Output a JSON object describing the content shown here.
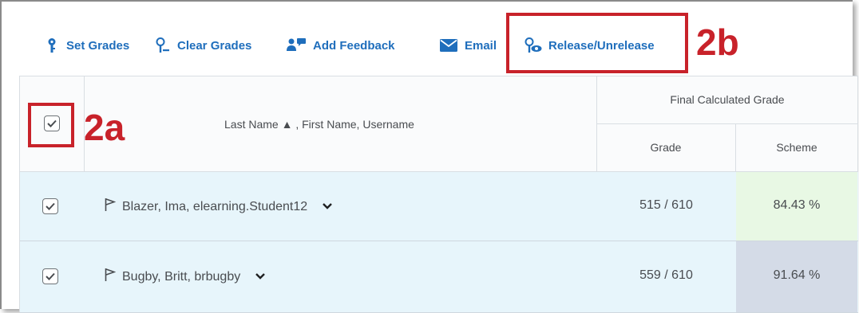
{
  "toolbar": {
    "set_grades": "Set Grades",
    "clear_grades": "Clear Grades",
    "add_feedback": "Add Feedback",
    "email": "Email",
    "release_unrelease": "Release/Unrelease"
  },
  "callouts": {
    "a": "2a",
    "b": "2b"
  },
  "table": {
    "name_header": "Last Name ▲ , First Name, Username",
    "group_header": "Final Calculated Grade",
    "grade_header": "Grade",
    "scheme_header": "Scheme",
    "rows": [
      {
        "name": "Blazer, Ima, elearning.Student12",
        "grade": "515 / 610",
        "scheme": "84.43 %",
        "scheme_color": "#e8f8e4"
      },
      {
        "name": "Bugby, Britt, brbugby",
        "grade": "559 / 610",
        "scheme": "91.64 %",
        "scheme_color": "#d4dbe7"
      }
    ]
  },
  "colors": {
    "accent": "#1f6ebc",
    "callout": "#c8222a",
    "row_bg": "#e7f5fb"
  }
}
